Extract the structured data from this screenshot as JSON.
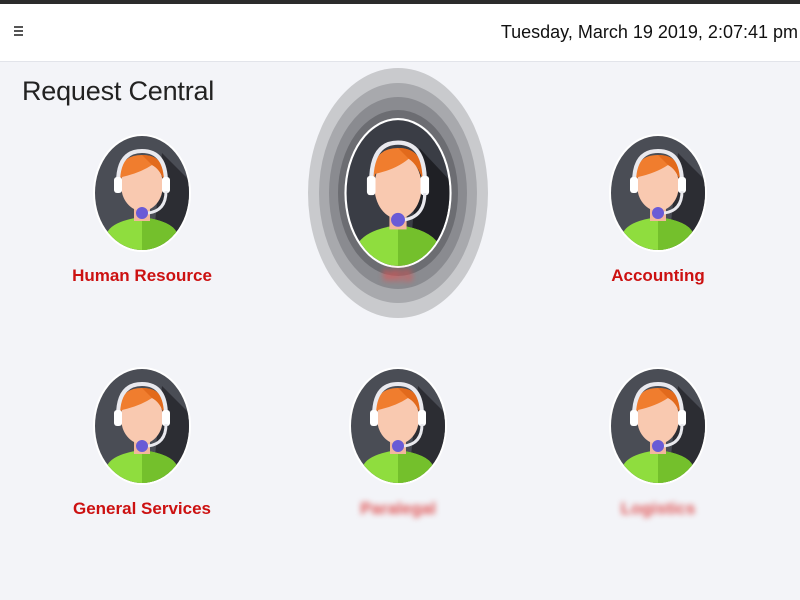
{
  "header": {
    "menu_icon": "hamburger-icon",
    "datetime": "Tuesday, March 19 2019, 2:07:41 pm"
  },
  "page": {
    "title": "Request Central"
  },
  "colors": {
    "label": "#cc1111",
    "background": "#f3f4f8",
    "avatar_bg": "#4a4d55",
    "hair": "#f07d2e",
    "skin": "#f9c9b0",
    "shirt": "#8fdd3e",
    "mic": "#6a5bd6"
  },
  "departments": [
    {
      "label": "Human Resource",
      "icon": "support-agent-icon",
      "highlighted": false,
      "blurred": false
    },
    {
      "label": "MIS",
      "icon": "support-agent-icon",
      "highlighted": true,
      "blurred": true
    },
    {
      "label": "Accounting",
      "icon": "support-agent-icon",
      "highlighted": false,
      "blurred": false
    },
    {
      "label": "General Services",
      "icon": "support-agent-icon",
      "highlighted": false,
      "blurred": false
    },
    {
      "label": "Paralegal",
      "icon": "support-agent-icon",
      "highlighted": false,
      "blurred": true
    },
    {
      "label": "Logistics",
      "icon": "support-agent-icon",
      "highlighted": false,
      "blurred": true
    }
  ]
}
